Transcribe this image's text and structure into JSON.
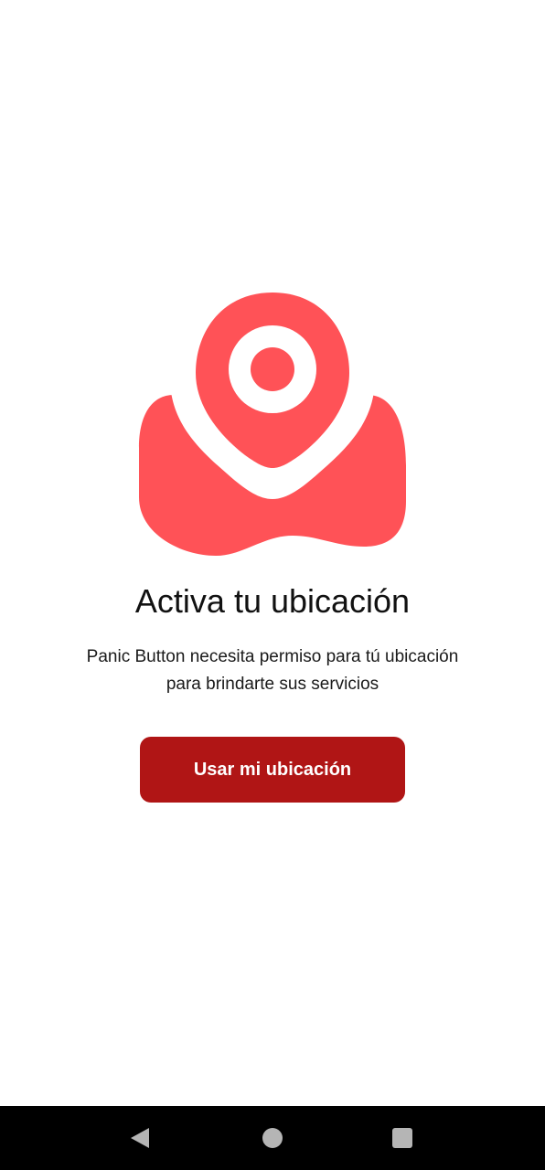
{
  "onboarding": {
    "title": "Activa tu ubicación",
    "description_line1": "Panic Button necesita permiso para tú ubicación",
    "description_line2": "para brindarte sus servicios",
    "button_label": "Usar mi ubicación",
    "illustration_icon": "location-pin-map-icon"
  },
  "colors": {
    "illustration": "#FF5257",
    "button": "#B01515",
    "button_text": "#FFFFFF",
    "nav_bar": "#000000",
    "nav_icons": "#B5B5B5"
  },
  "system_nav": {
    "back_icon": "back-triangle-icon",
    "home_icon": "home-circle-icon",
    "recents_icon": "recents-square-icon"
  }
}
